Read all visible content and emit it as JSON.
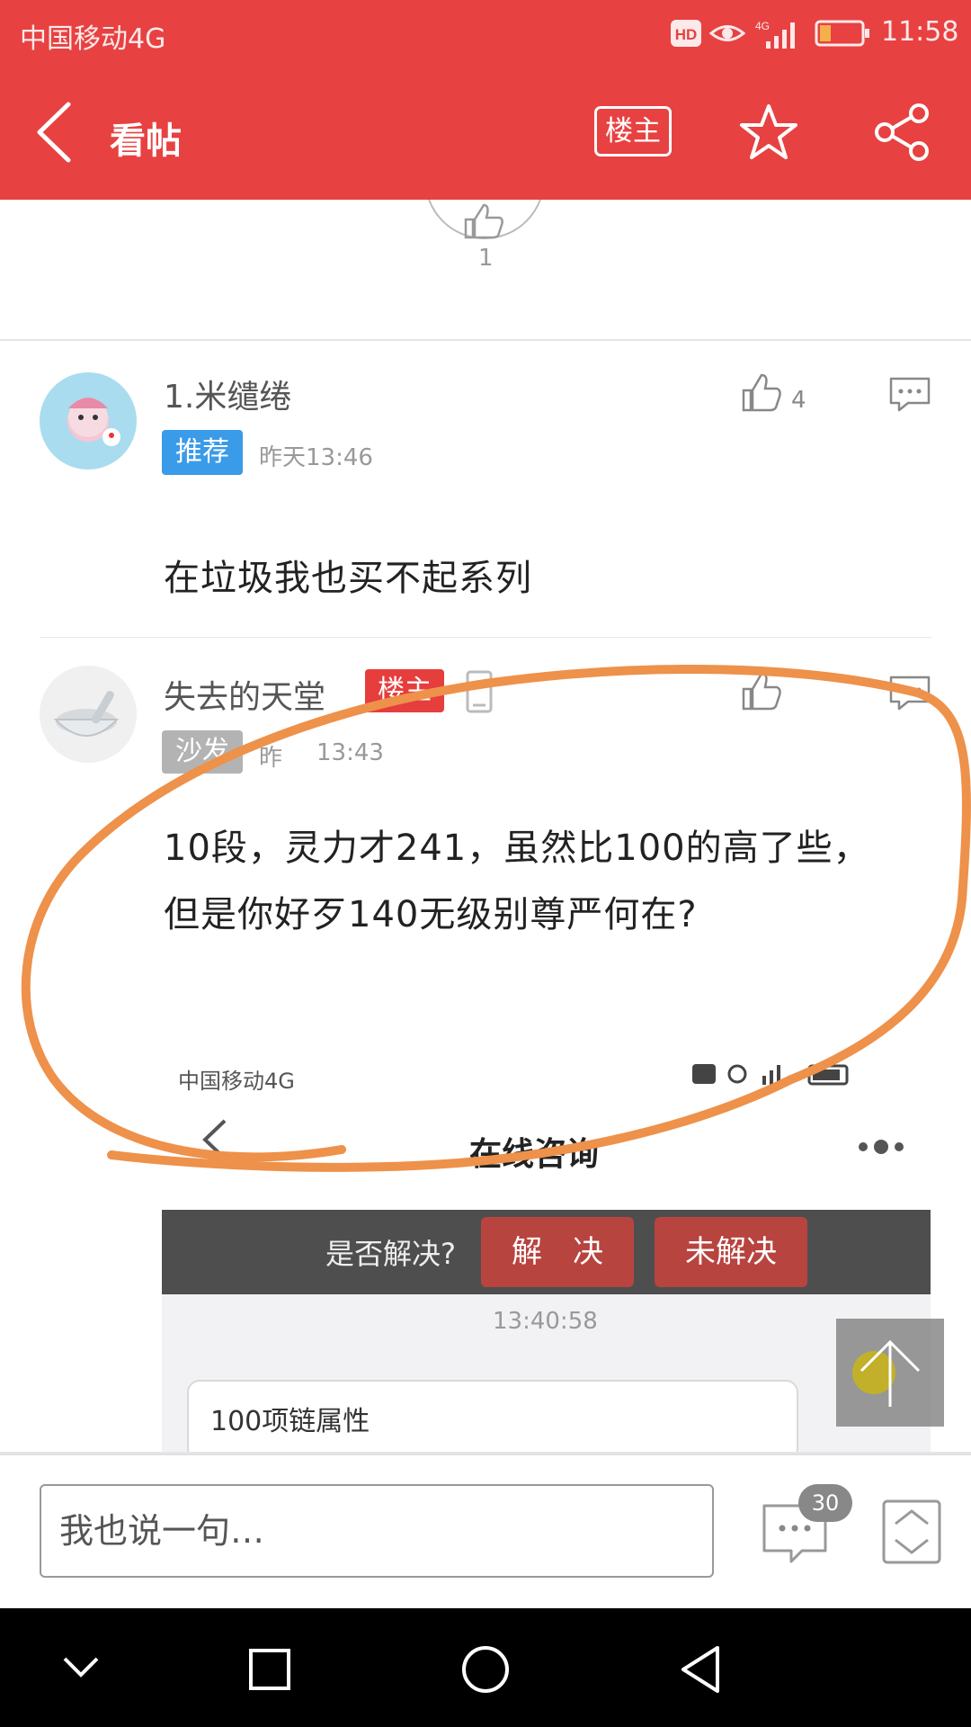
{
  "status_bar": {
    "carrier": "中国移动4G",
    "time": "11:58",
    "icons": [
      "hd-icon",
      "eye-icon",
      "signal-4g-icon",
      "battery-low-icon"
    ]
  },
  "title_bar": {
    "back_icon": "back-arrow-icon",
    "title": "看帖",
    "louzhu_button": "楼主",
    "star_icon": "star-icon",
    "share_icon": "share-icon",
    "accent_color": "#e84141"
  },
  "top_like": {
    "count": "1"
  },
  "posts": [
    {
      "floor_name": "1.米缱绻",
      "tag": "推荐",
      "tag_color": "#3a9be8",
      "time": "昨天13:46",
      "likes": "4",
      "text": "在垃圾我也买不起系列"
    },
    {
      "name": "失去的天堂",
      "owner_tag": "楼主",
      "owner_tag_color": "#e63d3d",
      "floor_tag": "沙发",
      "time_prefix": "昨",
      "time_suffix": "13:43",
      "text_line1": "10段，灵力才241，虽然比100的高了些，",
      "text_line2": "但是你好歹140无级别尊严何在?"
    }
  ],
  "embedded": {
    "carrier": "中国移动4G",
    "title": "在线咨询",
    "question": "是否解决?",
    "btn_solved": "解　决",
    "btn_unsolved": "未解决",
    "timestamp": "13:40:58",
    "message": "100项链属性"
  },
  "bottom_bar": {
    "input_placeholder": "我也说一句…",
    "comment_count": "30"
  },
  "nav_bar": {
    "icons": [
      "chevron-down-icon",
      "square-recent-icon",
      "circle-home-icon",
      "triangle-back-icon"
    ]
  }
}
